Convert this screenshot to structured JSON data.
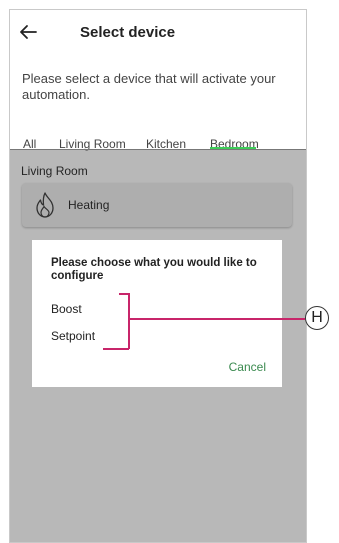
{
  "header": {
    "title": "Select device",
    "back_icon": "arrow-left-icon"
  },
  "description": "Please select a device that will activate your automation.",
  "tabs": [
    {
      "label": "All"
    },
    {
      "label": "Living Room"
    },
    {
      "label": "Kitchen"
    },
    {
      "label": "Bedroom",
      "selected": true
    }
  ],
  "room": {
    "label": "Living Room"
  },
  "device": {
    "name": "Heating",
    "icon": "flame-icon"
  },
  "dialog": {
    "title": "Please choose what you would like to configure",
    "options": [
      "Boost",
      "Setpoint"
    ],
    "cancel_label": "Cancel"
  },
  "callout": {
    "letter": "H",
    "color": "#c8256a"
  },
  "colors": {
    "accent": "#3dcd58",
    "cancel": "#3a8a4f"
  }
}
